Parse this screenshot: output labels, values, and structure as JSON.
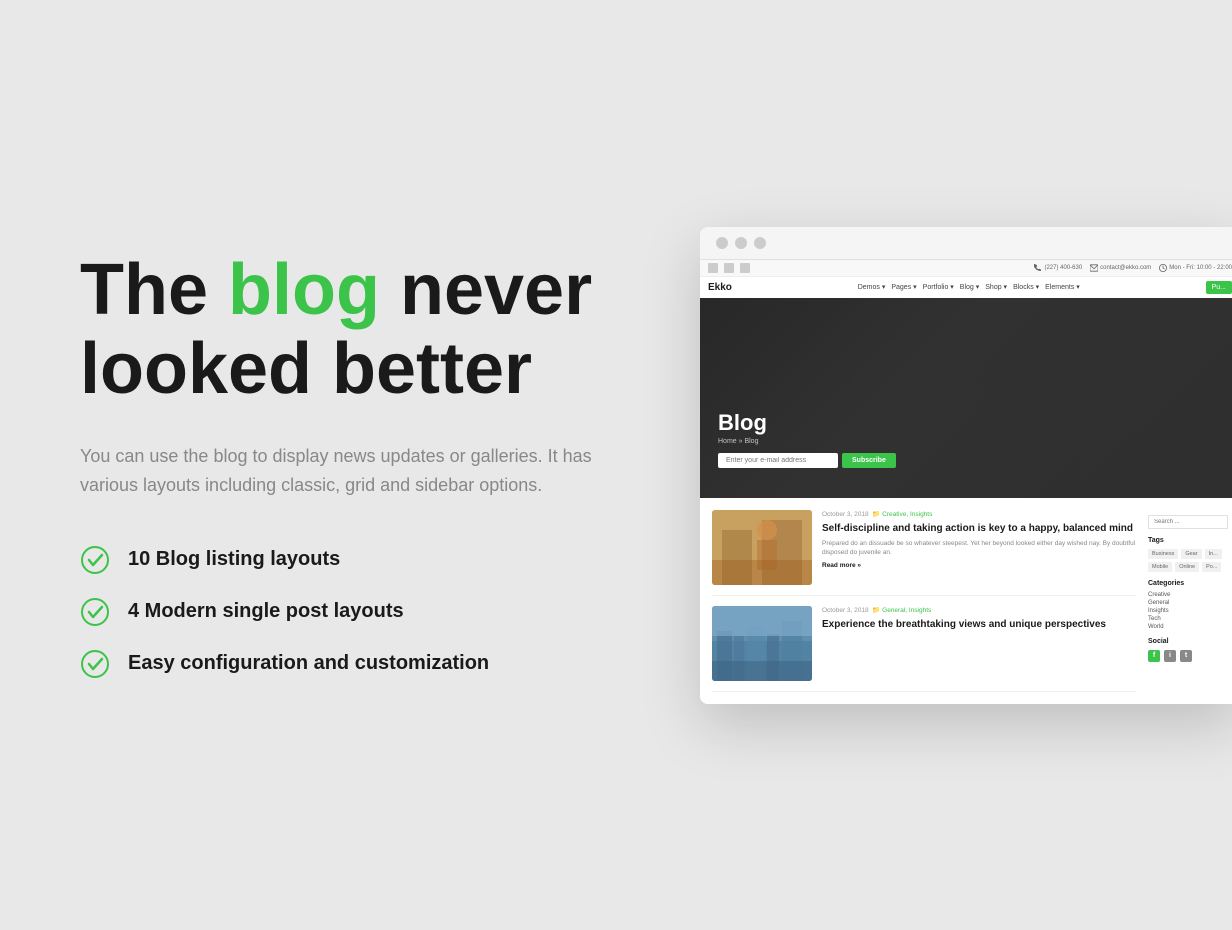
{
  "background_color": "#e8e8e8",
  "accent_color": "#3cc44a",
  "left": {
    "headline_part1": "The ",
    "headline_green": "blog",
    "headline_part2": " never\nlooked better",
    "description": "You can use the blog to display news updates or galleries. It has various layouts including classic, grid and sidebar options.",
    "features": [
      {
        "id": "feat1",
        "text": "10 Blog listing layouts"
      },
      {
        "id": "feat2",
        "text": "4 Modern single post layouts"
      },
      {
        "id": "feat3",
        "text": "Easy configuration and customization"
      }
    ]
  },
  "browser": {
    "dots": [
      "#f0f0f0",
      "#f0f0f0",
      "#f0f0f0"
    ],
    "topbar": {
      "phone": "(227) 400-630",
      "email": "contact@ekko.com",
      "hours": "Mon - Fri: 10:00 - 22:00",
      "socials": [
        "f",
        "i",
        "t"
      ]
    },
    "navbar": {
      "logo": "Ekko",
      "items": [
        "Demos",
        "Pages",
        "Portfolio",
        "Blog",
        "Shop",
        "Blocks",
        "Elements"
      ],
      "cta": "Pu..."
    },
    "hero": {
      "title": "Blog",
      "breadcrumb": "Home  »  Blog",
      "subscribe_placeholder": "Enter your e-mail address",
      "subscribe_btn": "Subscribe"
    },
    "posts": [
      {
        "date": "October 3, 2018",
        "category": "Creative, Insights",
        "title": "Self-discipline and taking action is key to a happy, balanced mind",
        "excerpt": "Prepared do an dissuade be so whatever steepest. Yet her beyond looked either day wished nay. By doubtful disposed do juvenile an.",
        "read_more": "Read more »",
        "thumb_type": "office"
      },
      {
        "date": "October 3, 2018",
        "category": "General, Insights",
        "title": "Experience the breathtaking views and unique perspectives",
        "excerpt": "",
        "read_more": "",
        "thumb_type": "city"
      }
    ],
    "sidebar": {
      "search_placeholder": "Search ...",
      "tags_title": "Tags",
      "tags": [
        "Business",
        "Gear",
        "In...",
        "Mobile",
        "Online",
        "Po..."
      ],
      "categories_title": "Categories",
      "categories": [
        "Creative",
        "General",
        "Insights",
        "Tech",
        "World"
      ],
      "social_title": "Social",
      "socials": [
        "f",
        "i",
        "t"
      ]
    }
  }
}
